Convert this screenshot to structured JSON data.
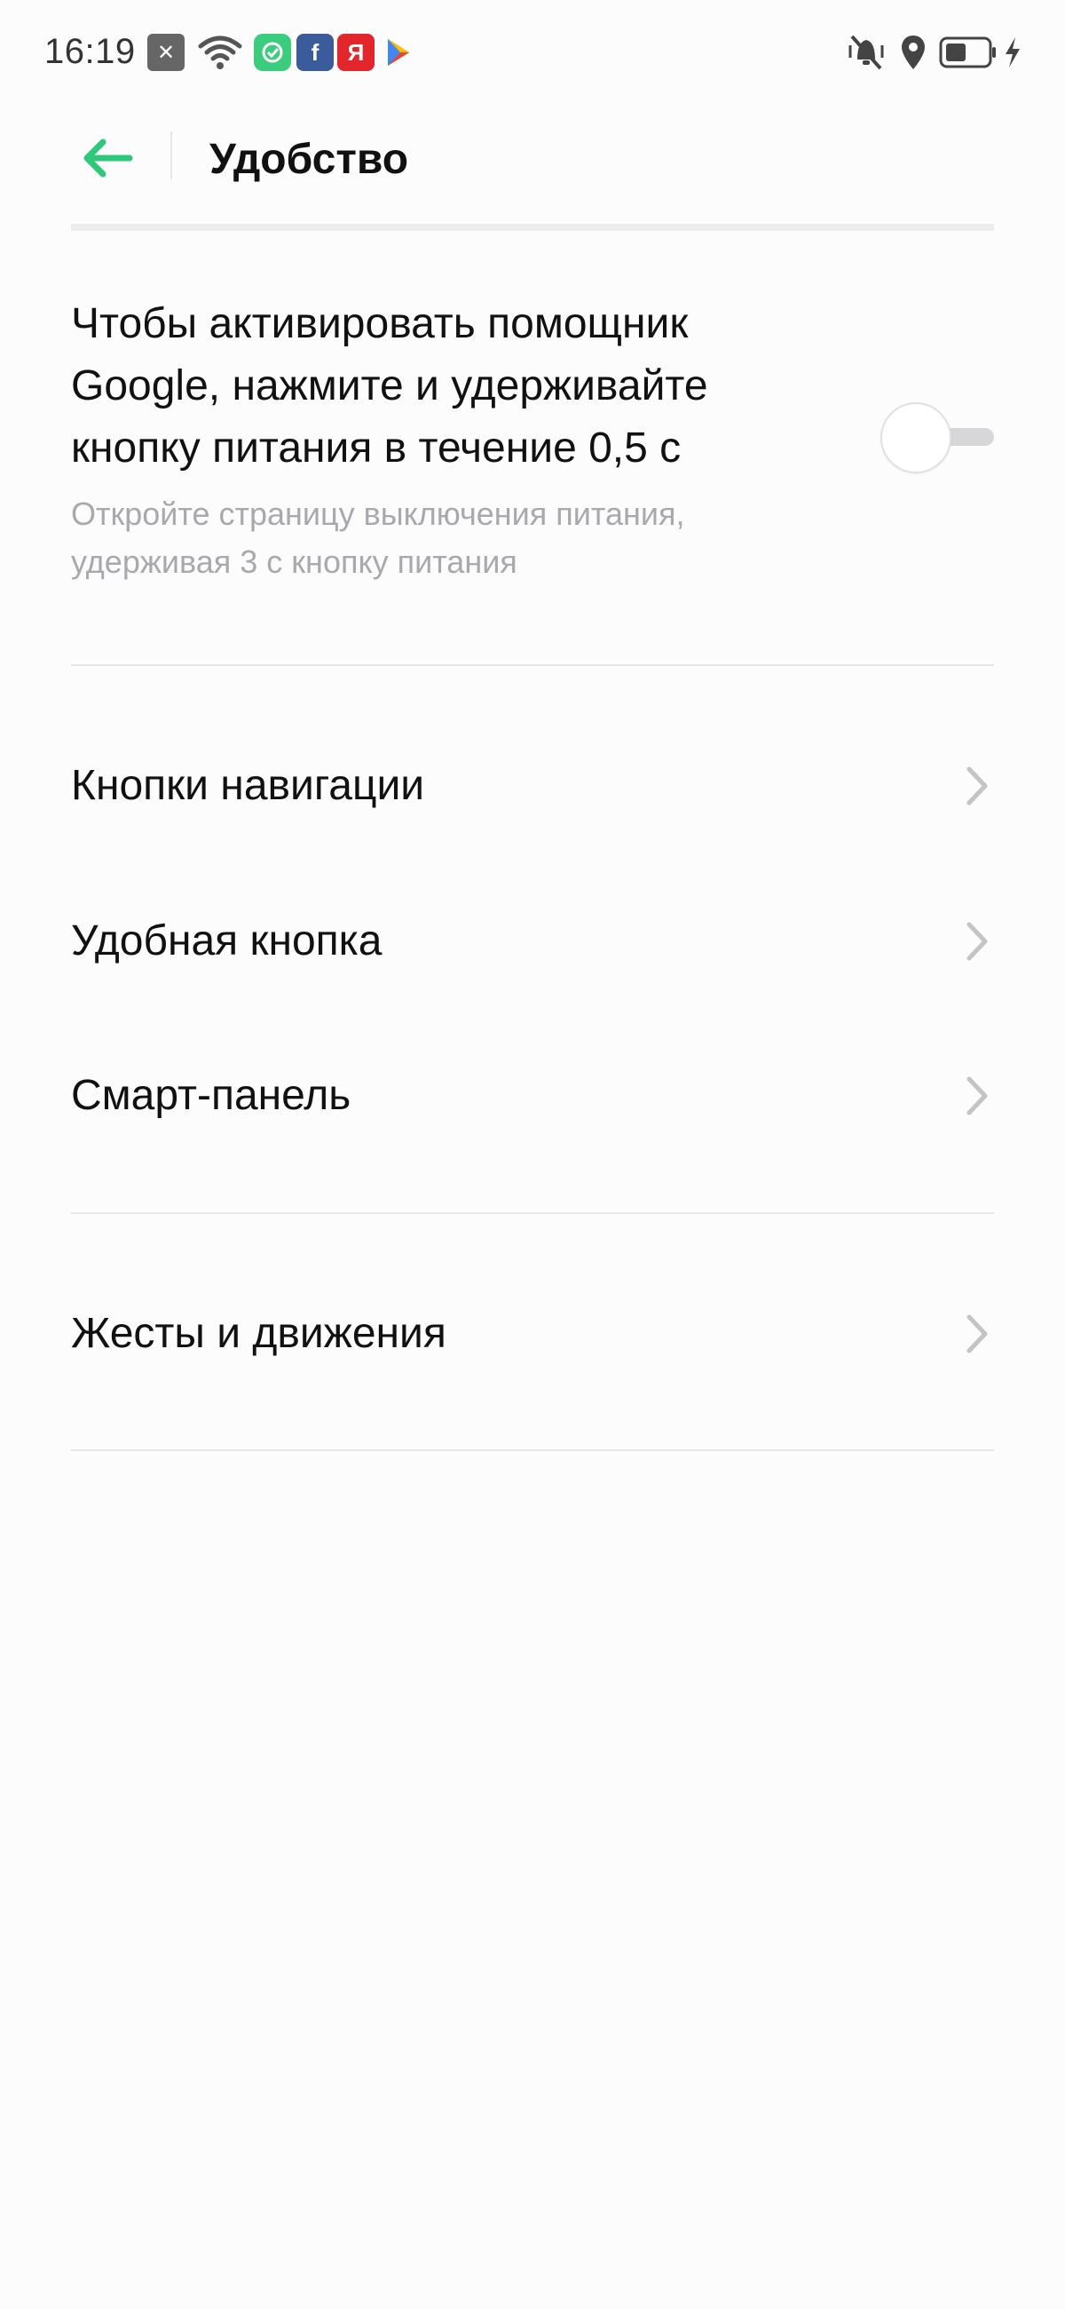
{
  "status_bar": {
    "time": "16:19",
    "left_icons": [
      "close-notification-icon",
      "wifi-icon",
      "sync-app-icon",
      "facebook-icon",
      "yandex-icon",
      "play-store-icon"
    ],
    "right_icons": [
      "vibrate-off-icon",
      "location-icon",
      "battery-icon",
      "charging-icon"
    ],
    "facebook_letter": "f",
    "yandex_letter": "Я",
    "colors": {
      "sync_green": "#3ccc7e",
      "facebook_blue": "#3b5b9b",
      "yandex_red": "#e3262b"
    }
  },
  "header": {
    "title": "Удобство",
    "back_icon": "arrow-left-icon",
    "accent": "#2fc77a"
  },
  "assistant_setting": {
    "title": "Чтобы активировать помощник Google, нажмите и удерживайте кнопку питания в течение 0,5 с",
    "subtitle": "Откройте страницу выключения питания, удерживая 3 с кнопку питания",
    "enabled": false
  },
  "menu": {
    "group1": [
      {
        "label": "Кнопки навигации",
        "icon": "chevron-right-icon"
      },
      {
        "label": "Удобная кнопка",
        "icon": "chevron-right-icon"
      },
      {
        "label": "Смарт-панель",
        "icon": "chevron-right-icon"
      }
    ],
    "group2": [
      {
        "label": "Жесты и движения",
        "icon": "chevron-right-icon"
      }
    ]
  }
}
